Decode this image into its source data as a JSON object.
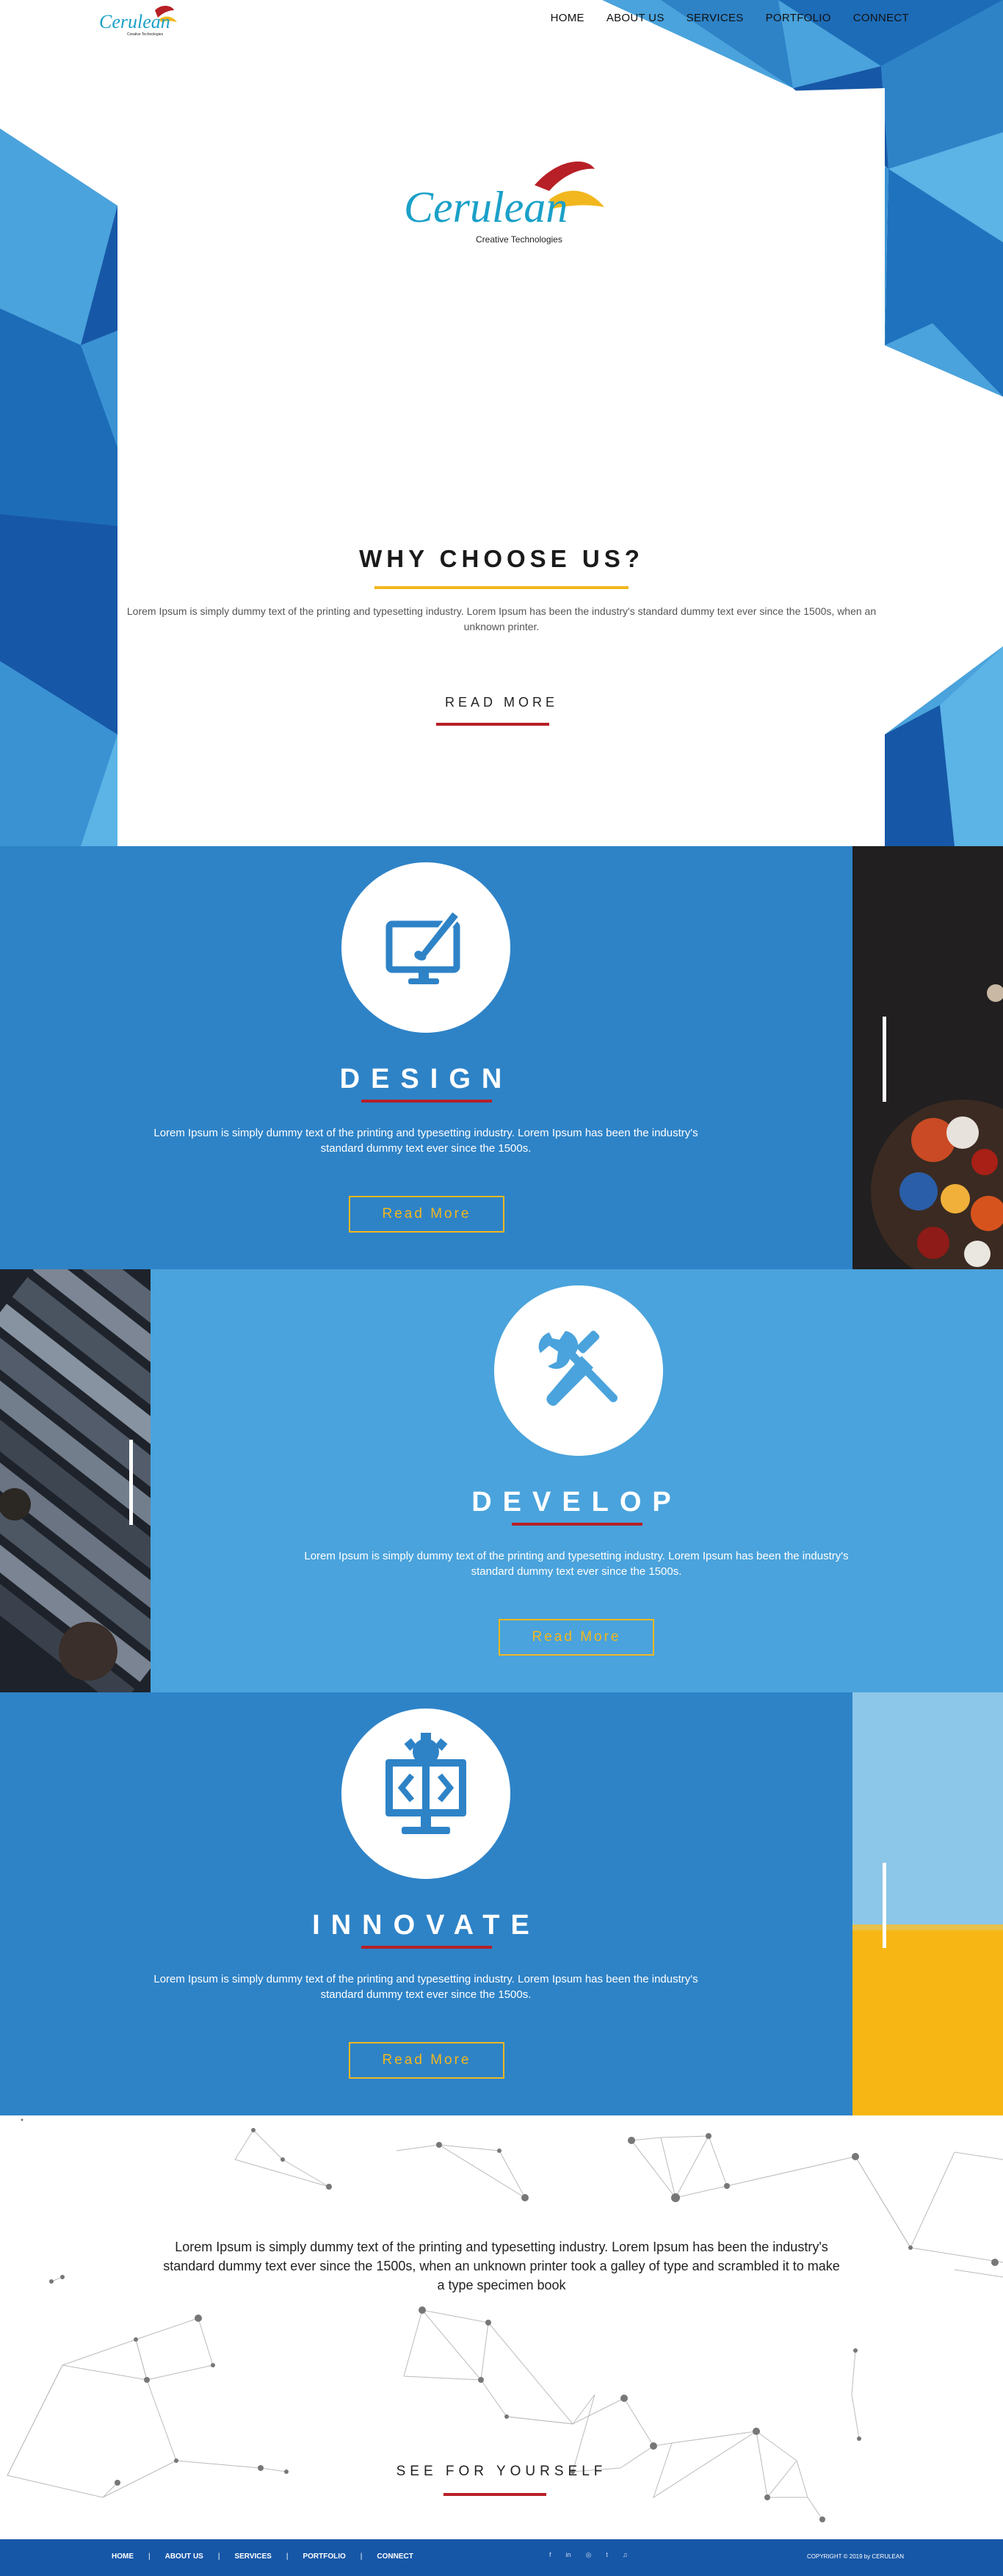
{
  "nav": {
    "logo_text": "Cerulean",
    "logo_sub": "Creative Technologies",
    "items": [
      "HOME",
      "ABOUT US",
      "SERVICES",
      "PORTFOLIO",
      "CONNECT"
    ]
  },
  "hero": {
    "logo_text": "Cerulean",
    "logo_sub": "Creative Technologies",
    "title": "WHY CHOOSE US?",
    "text": "Lorem Ipsum is simply dummy text of the printing and typesetting industry. Lorem Ipsum has been the industry's standard dummy text ever since the 1500s, when an unknown printer.",
    "read_more": "READ MORE"
  },
  "services": [
    {
      "title": "DESIGN",
      "icon": "monitor-brush-icon",
      "text": "Lorem Ipsum is simply dummy text of the printing and typesetting industry. Lorem Ipsum has been the industry's standard dummy text ever since the 1500s.",
      "button": "Read More"
    },
    {
      "title": "DEVELOP",
      "icon": "wrench-screwdriver-icon",
      "text": "Lorem Ipsum is simply dummy text of the printing and typesetting industry. Lorem Ipsum has been the industry's standard dummy text ever since the 1500s.",
      "button": "Read More"
    },
    {
      "title": "INNOVATE",
      "icon": "gear-code-monitor-icon",
      "text": "Lorem Ipsum is simply dummy text of the printing and typesetting industry. Lorem Ipsum has been the industry's standard dummy text ever since the 1500s.",
      "button": "Read More"
    }
  ],
  "network": {
    "text": "Lorem Ipsum is simply dummy text of the printing and typesetting industry. Lorem Ipsum has been the industry's standard dummy text ever since the 1500s, when an unknown printer took a galley of type and scrambled it to make a type specimen book",
    "cta": "SEE FOR YOURSELF"
  },
  "footer": {
    "nav": [
      "HOME",
      "ABOUT US",
      "SERVICES",
      "PORTFOLIO",
      "CONNECT"
    ],
    "social": [
      "f",
      "in",
      "◎",
      "t",
      "♫"
    ],
    "copyright": "COPYRIGHT © 2019 by CERULEAN"
  },
  "colors": {
    "panel_dark": "#2e83c7",
    "panel_light": "#4aa3dc",
    "accent_yellow": "#f2b71e",
    "accent_red": "#b72026",
    "footer": "#1757a7"
  }
}
